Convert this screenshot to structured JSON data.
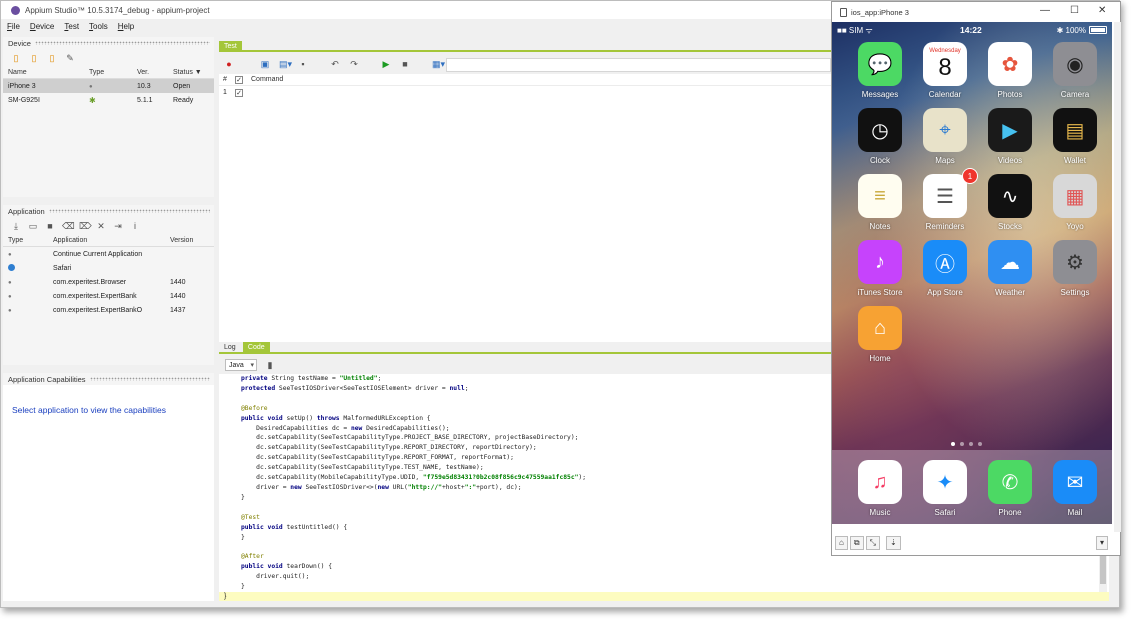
{
  "window": {
    "title": "Appium Studio™ 10.5.3174_debug - appium-project"
  },
  "menu": [
    "File",
    "Device",
    "Test",
    "Tools",
    "Help"
  ],
  "device_panel": {
    "title": "Device",
    "columns": [
      "Name",
      "Type",
      "Ver.",
      "Status ▼"
    ],
    "rows": [
      {
        "name": "iPhone 3",
        "type": "apple",
        "ver": "10.3",
        "status": "Open"
      },
      {
        "name": "SM-G925I",
        "type": "android",
        "ver": "5.1.1",
        "status": "Ready"
      }
    ]
  },
  "application_panel": {
    "title": "Application",
    "columns": [
      "Type",
      "Application",
      "Version"
    ],
    "rows": [
      {
        "type": "apple",
        "name": "Continue Current Application",
        "version": ""
      },
      {
        "type": "safari",
        "name": "Safari",
        "version": ""
      },
      {
        "type": "apple",
        "name": "com.experitest.Browser",
        "version": "1440"
      },
      {
        "type": "apple",
        "name": "com.experitest.ExpertBank",
        "version": "1440"
      },
      {
        "type": "apple",
        "name": "com.experitest.ExpertBankO",
        "version": "1437"
      }
    ]
  },
  "capabilities_panel": {
    "title": "Application Capabilities",
    "message": "Select application to view the capabilities"
  },
  "test_panel": {
    "tab": "Test",
    "grid_headers": {
      "num": "#",
      "command": "Command"
    },
    "rows": [
      {
        "num": "1"
      }
    ]
  },
  "code_panel": {
    "tabs": [
      "Log",
      "Code"
    ],
    "language": "Java",
    "lines": [
      "private String testName = \"Untitled\";",
      "protected SeeTestIOSDriver<SeeTestIOSElement> driver = null;",
      "",
      "@Before",
      "public void setUp() throws MalformedURLException {",
      "    DesiredCapabilities dc = new DesiredCapabilities();",
      "    dc.setCapability(SeeTestCapabilityType.PROJECT_BASE_DIRECTORY, projectBaseDirectory);",
      "    dc.setCapability(SeeTestCapabilityType.REPORT_DIRECTORY, reportDirectory);",
      "    dc.setCapability(SeeTestCapabilityType.REPORT_FORMAT, reportFormat);",
      "    dc.setCapability(SeeTestCapabilityType.TEST_NAME, testName);",
      "    dc.setCapability(MobileCapabilityType.UDID, \"f759e5d83431?0b2c08f856c9c47559aa1fc85c\");",
      "    driver = new SeeTestIOSDriver<>(new URL(\"http://\"+host+\":\"+port), dc);",
      "}",
      "",
      "@Test",
      "public void testUntitled() {",
      "}",
      "",
      "@After",
      "public void tearDown() {",
      "    driver.quit();",
      "}"
    ],
    "status_line": "}"
  },
  "phone": {
    "window_title": "ios_app:iPhone 3",
    "carrier": "■■ SIM ᯤ",
    "time": "14:22",
    "battery": "100%",
    "apps": [
      {
        "label": "Messages",
        "icon": "messages-icon",
        "color": "#4cd964"
      },
      {
        "label": "Calendar",
        "icon": "calendar-icon",
        "color": "#ffffff",
        "weekday": "Wednesday",
        "day": "8"
      },
      {
        "label": "Photos",
        "icon": "photos-icon",
        "color": "#ffffff"
      },
      {
        "label": "Camera",
        "icon": "camera-icon",
        "color": "#8e8e93"
      },
      {
        "label": "Clock",
        "icon": "clock-icon",
        "color": "#111111"
      },
      {
        "label": "Maps",
        "icon": "maps-icon",
        "color": "#e8e2c9"
      },
      {
        "label": "Videos",
        "icon": "videos-icon",
        "color": "#1a1a1a"
      },
      {
        "label": "Wallet",
        "icon": "wallet-icon",
        "color": "#111111"
      },
      {
        "label": "Notes",
        "icon": "notes-icon",
        "color": "#fffdf0"
      },
      {
        "label": "Reminders",
        "icon": "reminders-icon",
        "color": "#ffffff",
        "badge": "1"
      },
      {
        "label": "Stocks",
        "icon": "stocks-icon",
        "color": "#111111"
      },
      {
        "label": "Yoyo",
        "icon": "yoyo-icon",
        "color": "#d8d8d8"
      },
      {
        "label": "iTunes Store",
        "icon": "itunes-icon",
        "color": "#c643fc"
      },
      {
        "label": "App Store",
        "icon": "app-store-icon",
        "color": "#1a8cf8"
      },
      {
        "label": "Weather",
        "icon": "weather-icon",
        "color": "#2f8ff2"
      },
      {
        "label": "Settings",
        "icon": "settings-icon",
        "color": "#8e8e93"
      },
      {
        "label": "Home",
        "icon": "home-icon",
        "color": "#f7a233"
      }
    ],
    "dock": [
      {
        "label": "Music",
        "icon": "music-icon",
        "color": "#ffffff"
      },
      {
        "label": "Safari",
        "icon": "safari-icon",
        "color": "#ffffff"
      },
      {
        "label": "Phone",
        "icon": "phone-icon",
        "color": "#4cd964"
      },
      {
        "label": "Mail",
        "icon": "mail-icon",
        "color": "#1a8cf8"
      }
    ]
  }
}
